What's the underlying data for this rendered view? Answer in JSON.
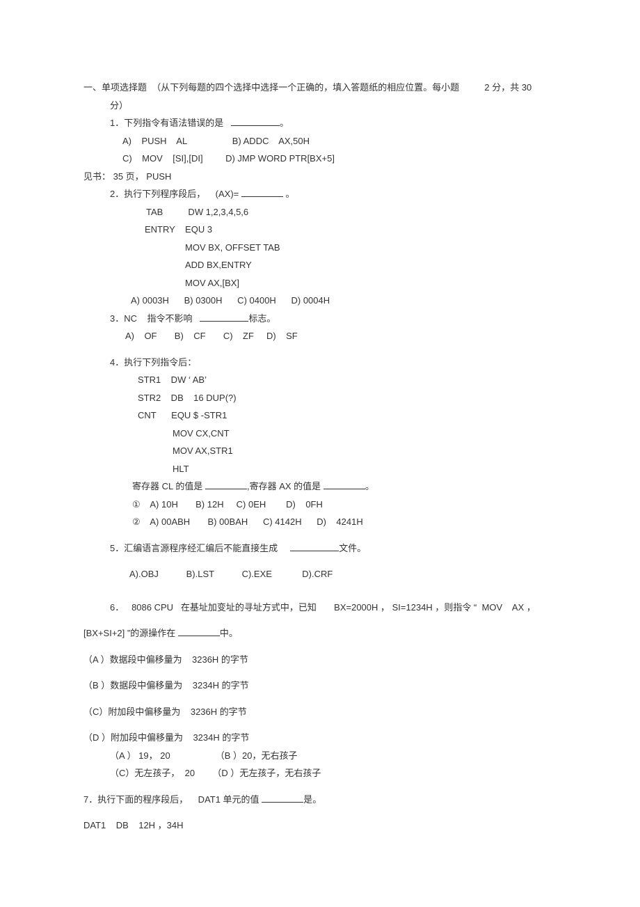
{
  "section_intro_a": "一、单项选择题  （从下列每题的四个选择中选择一个正确的，填入答题纸的相应位置。每小题",
  "section_intro_b": "2 分，共 30",
  "section_intro_c": "分）",
  "q1_stem": "1．下列指令有语法错误的是",
  "q1_tail": "。",
  "q1_a": "A)    PUSH    AL",
  "q1_b": "B) ADDC    AX,50H",
  "q1_c": "C)    MOV    [SI],[DI]",
  "q1_d": "D) JMP WORD PTR[BX+5]",
  "q1_note": "见书： 35 页， PUSH",
  "q2_stem": "2．执行下列程序段后，    (AX)=",
  "q2_tail": " 。",
  "q2_code1": "TAB          DW 1,2,3,4,5,6",
  "q2_code2": "ENTRY    EQU 3",
  "q2_code3": "MOV BX, OFFSET TAB",
  "q2_code4": "ADD BX,ENTRY",
  "q2_code5": "MOV AX,[BX]",
  "q2_opts": "A) 0003H      B) 0300H      C) 0400H      D) 0004H",
  "q3_stem": "3．NC    指令不影响",
  "q3_tail": "标志。",
  "q3_opts": "A)    OF       B)    CF       C)    ZF     D)    SF",
  "q4_stem": "4．执行下列指令后：",
  "q4_code1": "STR1    DW ‘ AB’",
  "q4_code2": "STR2    DB    16 DUP(?)",
  "q4_code3": "CNT      EQU $ -STR1",
  "q4_code4": "MOV CX,CNT",
  "q4_code5": "MOV AX,STR1",
  "q4_code6": "HLT",
  "q4_mid_a": "寄存器 CL 的值是",
  "q4_mid_b": ",寄存器 AX 的值是",
  "q4_mid_c": "。",
  "q4_o1": "①    A) 10H       B) 12H     C) 0EH        D)    0FH",
  "q4_o2": "②    A) 00ABH       B) 00BAH      C) 4142H      D)    4241H",
  "q5_stem": "5．汇编语言源程序经汇编后不能直接生成",
  "q5_tail": "文件。",
  "q5_opts": "A).OBJ           B).LST           C).EXE            D).CRF",
  "q6_a": "6．   8086 CPU   在基址加变址的寻址方式中，已知       BX=2000H ， SI=1234H ，则指令 “  MOV    AX ，",
  "q6_b_pre": "[BX+SI+2] ”的源操作在",
  "q6_b_post": "中。",
  "q6_optA": "（A ）数据段中偏移量为    3236H 的字节",
  "q6_optB": "（B ）数据段中偏移量为    3234H 的字节",
  "q6_optC": "（C）附加段中偏移量为    3236H 的字节",
  "q6_optD": "（D ）附加段中偏移量为    3234H 的字节",
  "q6_extra1": "（A ） 19， 20                  （B ）20，无右孩子",
  "q6_extra2": "（C）无左孩子，  20       （D ）无左孩子，无右孩子",
  "q7_stem": "7．执行下面的程序段后，    DAT1 单元的值",
  "q7_tail": "是。",
  "q7_code1": "DAT1    DB    12H ，34H"
}
